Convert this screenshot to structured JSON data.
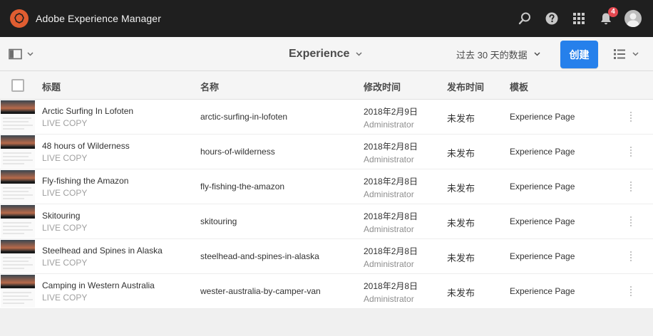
{
  "header": {
    "app_title": "Adobe Experience Manager",
    "notification_count": "4",
    "icons": [
      "adobe-logo-icon",
      "search-icon",
      "help-icon",
      "solutions-grid-icon",
      "bell-icon",
      "user-avatar"
    ]
  },
  "toolbar": {
    "title": "Experience",
    "date_filter": "过去 30 天的数据",
    "create_label": "创建"
  },
  "table": {
    "columns": {
      "title": "标题",
      "name": "名称",
      "modified": "修改时间",
      "published": "发布时间",
      "template": "模板"
    },
    "rows": [
      {
        "title": "Arctic Surfing In Lofoten",
        "status": "LIVE COPY",
        "name": "arctic-surfing-in-lofoten",
        "modified_date": "2018年2月9日",
        "modified_by": "Administrator",
        "published": "未发布",
        "template": "Experience Page"
      },
      {
        "title": "48 hours of Wilderness",
        "status": "LIVE COPY",
        "name": "hours-of-wilderness",
        "modified_date": "2018年2月8日",
        "modified_by": "Administrator",
        "published": "未发布",
        "template": "Experience Page"
      },
      {
        "title": "Fly-fishing the Amazon",
        "status": "LIVE COPY",
        "name": "fly-fishing-the-amazon",
        "modified_date": "2018年2月8日",
        "modified_by": "Administrator",
        "published": "未发布",
        "template": "Experience Page"
      },
      {
        "title": "Skitouring",
        "status": "LIVE COPY",
        "name": "skitouring",
        "modified_date": "2018年2月8日",
        "modified_by": "Administrator",
        "published": "未发布",
        "template": "Experience Page"
      },
      {
        "title": "Steelhead and Spines in Alaska",
        "status": "LIVE COPY",
        "name": "steelhead-and-spines-in-alaska",
        "modified_date": "2018年2月8日",
        "modified_by": "Administrator",
        "published": "未发布",
        "template": "Experience Page"
      },
      {
        "title": "Camping in Western Australia",
        "status": "LIVE COPY",
        "name": "wester-australia-by-camper-van",
        "modified_date": "2018年2月8日",
        "modified_by": "Administrator",
        "published": "未发布",
        "template": "Experience Page"
      }
    ]
  },
  "colors": {
    "header_bg": "#1f1f1f",
    "brand_accent": "#e05d31",
    "primary_button": "#2680eb",
    "badge": "#e34850"
  }
}
